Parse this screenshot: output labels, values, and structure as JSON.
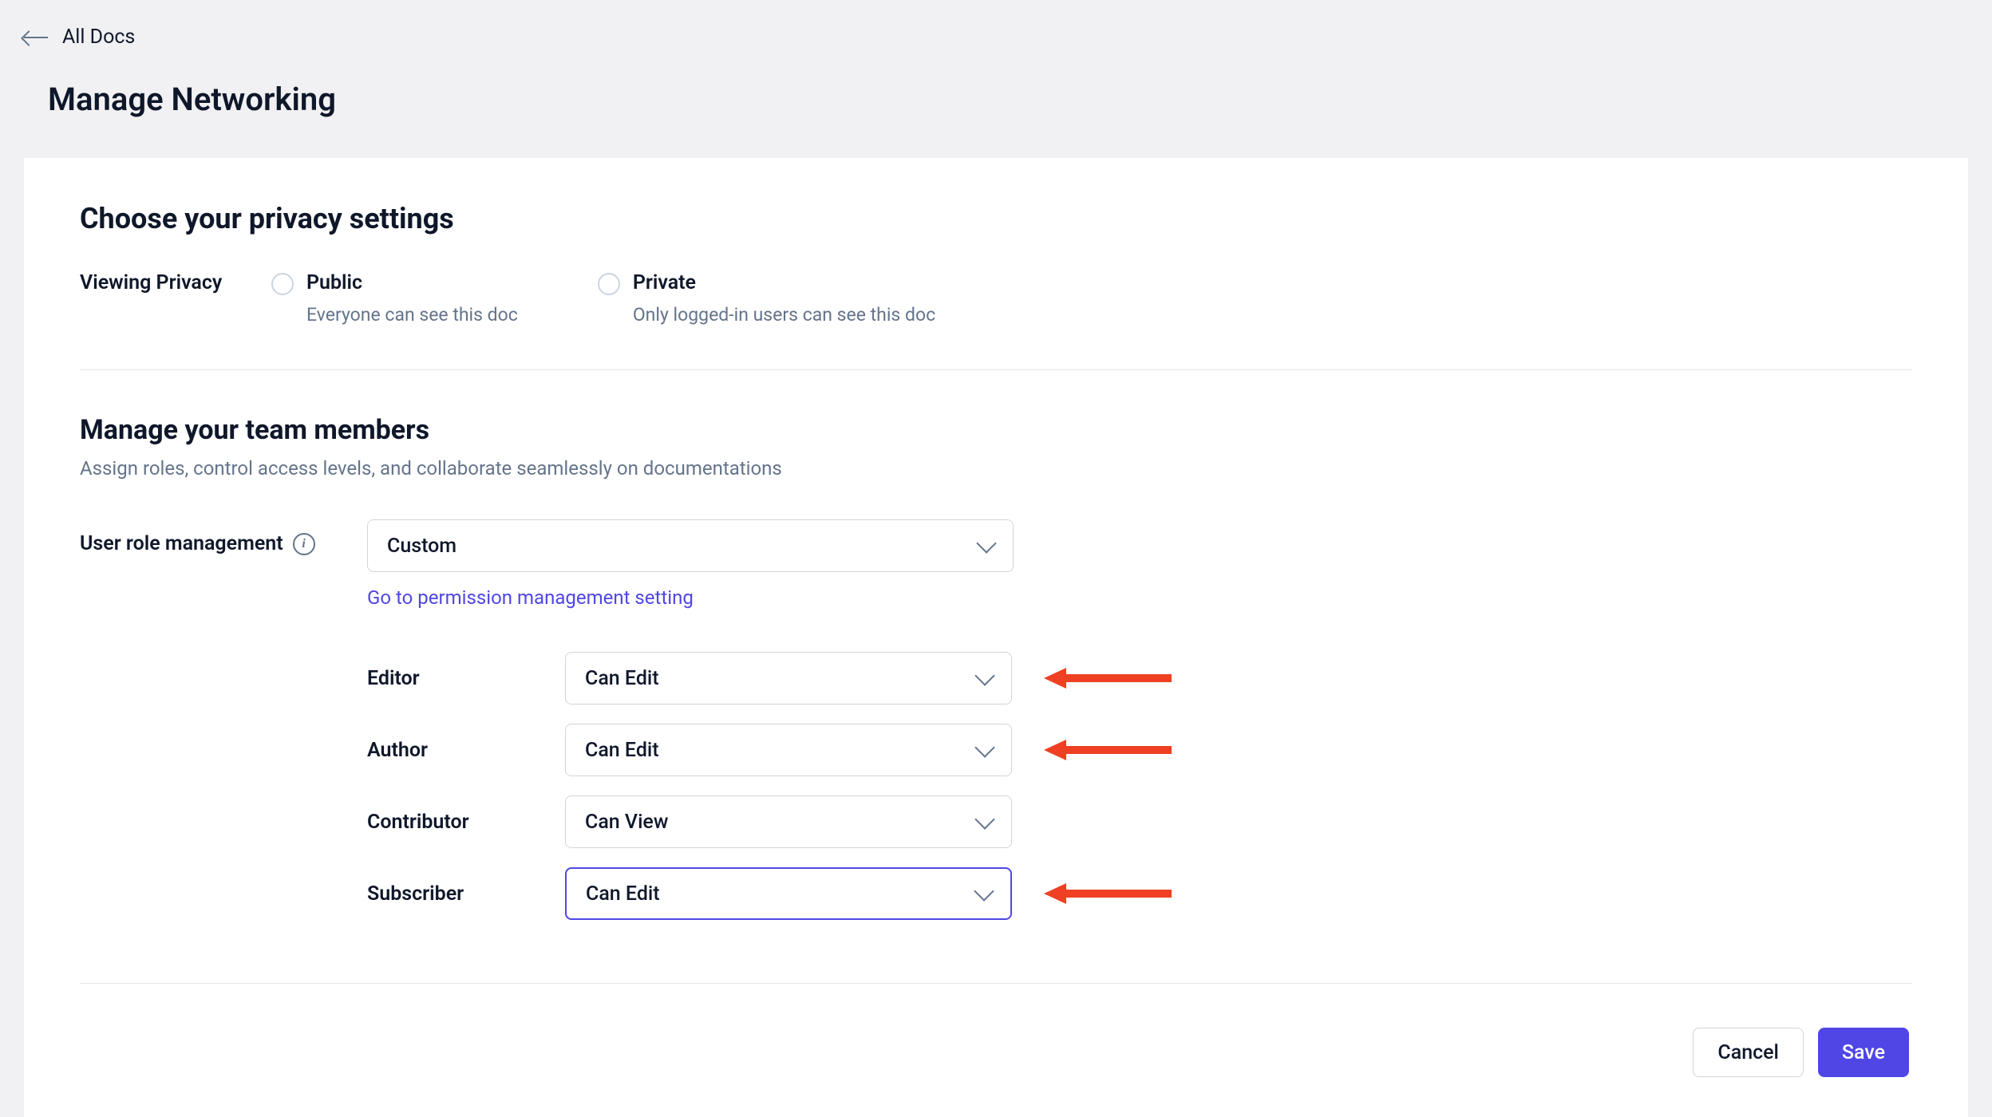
{
  "nav": {
    "back_label": "All Docs"
  },
  "page": {
    "title": "Manage Networking"
  },
  "privacy": {
    "section_title": "Choose your privacy settings",
    "label": "Viewing Privacy",
    "options": {
      "public": {
        "title": "Public",
        "desc": "Everyone can see this doc"
      },
      "private": {
        "title": "Private",
        "desc": "Only logged-in users can see this doc"
      }
    }
  },
  "team": {
    "section_title": "Manage your team members",
    "subtitle": "Assign roles, control access levels, and collaborate seamlessly on documentations",
    "role_mgmt_label": "User role management",
    "role_mgmt_value": "Custom",
    "perm_link": "Go to permission management setting",
    "roles": {
      "editor": {
        "label": "Editor",
        "value": "Can Edit"
      },
      "author": {
        "label": "Author",
        "value": "Can Edit"
      },
      "contributor": {
        "label": "Contributor",
        "value": "Can View"
      },
      "subscriber": {
        "label": "Subscriber",
        "value": "Can Edit"
      }
    }
  },
  "footer": {
    "cancel": "Cancel",
    "save": "Save"
  }
}
